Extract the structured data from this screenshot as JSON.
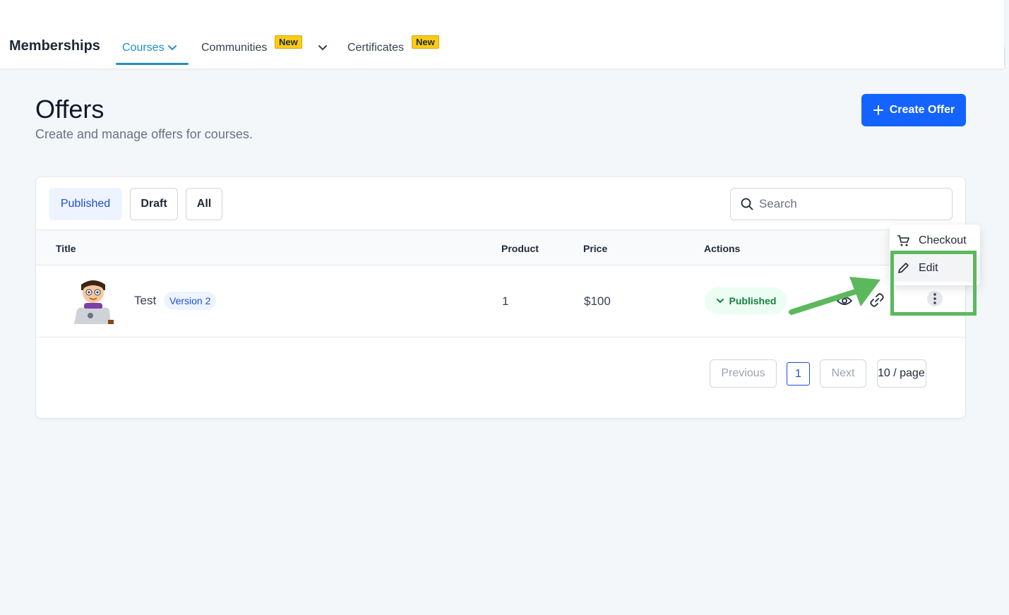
{
  "nav": {
    "brand": "Memberships",
    "courses": "Courses",
    "communities": "Communities",
    "certificates": "Certificates",
    "new_badge": "New"
  },
  "header": {
    "title": "Offers",
    "subtitle": "Create and manage offers for courses.",
    "create_button": "Create Offer"
  },
  "filters": {
    "published": "Published",
    "draft": "Draft",
    "all": "All",
    "search_placeholder": "Search"
  },
  "table": {
    "columns": [
      "Title",
      "Product",
      "Price",
      "Actions"
    ],
    "rows": [
      {
        "title": "Test",
        "version": "Version 2",
        "product": "1",
        "price": "$100",
        "status": "Published"
      }
    ]
  },
  "pagination": {
    "previous": "Previous",
    "current_page": "1",
    "next": "Next",
    "page_size": "10 / page"
  },
  "menu": {
    "checkout": "Checkout",
    "edit": "Edit"
  },
  "colors": {
    "primary": "#1463ff",
    "accent_nav": "#1f8fc8",
    "status_green": "#15803d",
    "annotation_green": "#5cb85c",
    "badge_yellow": "#facc15"
  }
}
